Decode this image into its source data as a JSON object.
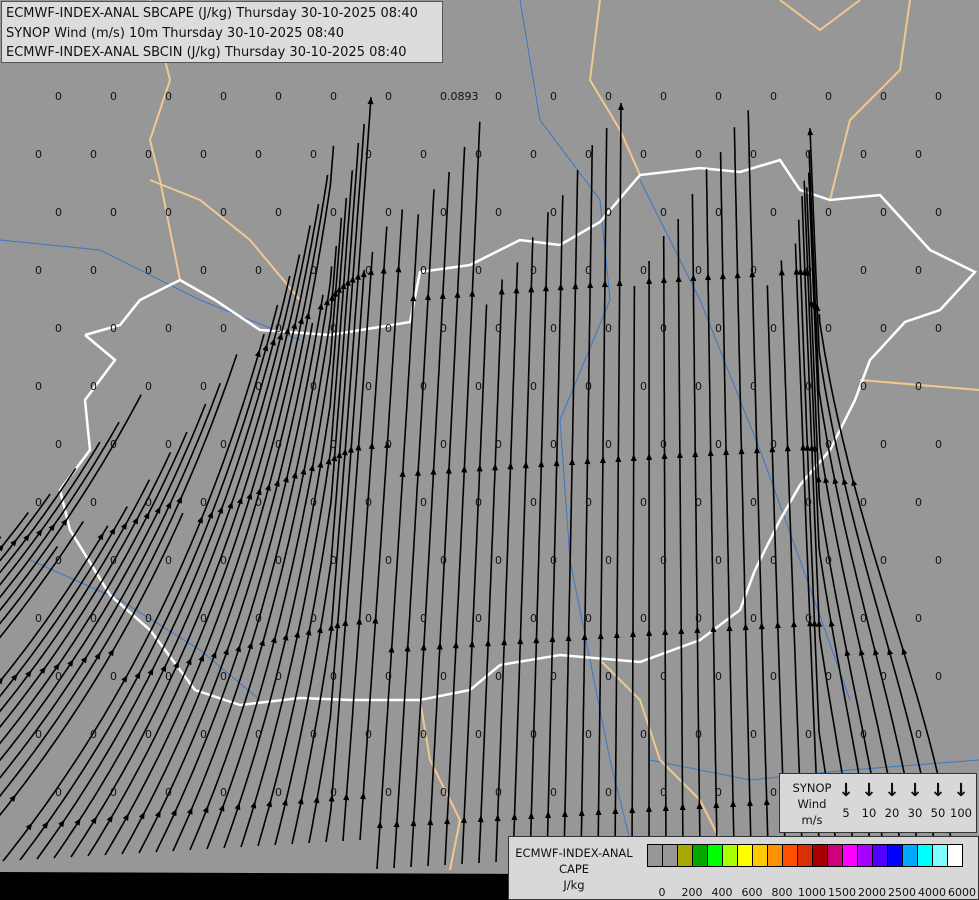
{
  "titles": [
    "ECMWF-INDEX-ANAL SBCAPE (J/kg) Thursday 30-10-2025 08:40",
    "SYNOP Wind (m/s) 10m Thursday 30-10-2025 08:40",
    "ECMWF-INDEX-ANAL SBCIN (J/kg) Thursday 30-10-2025 08:40"
  ],
  "synop_legend": {
    "label_lines": [
      "SYNOP",
      "Wind",
      "m/s"
    ],
    "speeds": [
      "5",
      "10",
      "20",
      "30",
      "50",
      "100"
    ],
    "arrow_icon": "down-arrow-icon"
  },
  "cape_legend": {
    "label_lines": [
      "ECMWF-INDEX-ANAL",
      "CAPE",
      "J/kg"
    ],
    "colors": [
      "#979797",
      "#979797",
      "#a8a800",
      "#00a800",
      "#00ff00",
      "#a8ff00",
      "#ffff00",
      "#ffc800",
      "#ff9000",
      "#ff5000",
      "#d83000",
      "#a80000",
      "#d0007a",
      "#ff00ff",
      "#a800ff",
      "#5000ff",
      "#0000ff",
      "#00a8ff",
      "#00ffff",
      "#80ffff",
      "#ffffff"
    ],
    "ticks": [
      "0",
      "200",
      "400",
      "600",
      "800",
      "1000",
      "1500",
      "2000",
      "2500",
      "4000",
      "6000"
    ]
  },
  "map": {
    "background": "#979797",
    "country_border_color": "#ffffff",
    "other_border_color": "#f0c890",
    "river_color": "#3a78c8",
    "streamline_color": "#000000",
    "station_values": [
      "0",
      "0.0893"
    ]
  }
}
